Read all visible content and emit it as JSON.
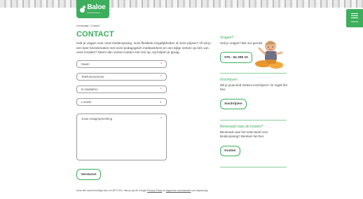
{
  "brand": {
    "name": "Baloe",
    "tagline": "kinderopvang",
    "primary_color": "#3cae5c"
  },
  "menu": {
    "label": "menu"
  },
  "breadcrumb": {
    "home": "Homepage",
    "separator": "/",
    "current": "Contact"
  },
  "page": {
    "title": "CONTACT",
    "intro": "Heb je vragen over onze kinderopvang, onze flexibele mogelijkheden of onze prijzen? Of wil je een keer kennismaken met onze pedagogisch medewerkers en een kijkje nemen op één van onze locaties? Neem dan vooral contact met ons op, wij helpen je graag."
  },
  "form": {
    "name_placeholder": "Naam",
    "phone_placeholder": "Telefoonnummer",
    "email_placeholder": "E-mailadres",
    "location_value": "Locatie",
    "message_placeholder": "Jouw vraag/opmerking",
    "required_marker": "*",
    "submit_label": "Versturen"
  },
  "recaptcha": {
    "text_before": "Deze site wordt beveiligd door reCAPTCHA. Hierop zijn de Google",
    "privacy_link": "Privacy Policy",
    "text_middle": "en",
    "terms_link": "Algemene voorwaarden",
    "text_after": "van toepassing."
  },
  "sidebar": {
    "questions": {
      "heading": "Vragen?",
      "text": "Heb je vragen? Bel ons gerust!",
      "phone": "075 - 64 299 10"
    },
    "enroll": {
      "heading": "Inschrijven",
      "text": "Wil je jouw kind meteen inschrijven? Je regelt het hier.",
      "button": "Inschrijven"
    },
    "costs": {
      "heading": "Benieuwd naar de kosten?",
      "text": "Benieuwd naar het netto tarief voor kinderopvang? Bereken het hier.",
      "button": "Kosten"
    }
  }
}
